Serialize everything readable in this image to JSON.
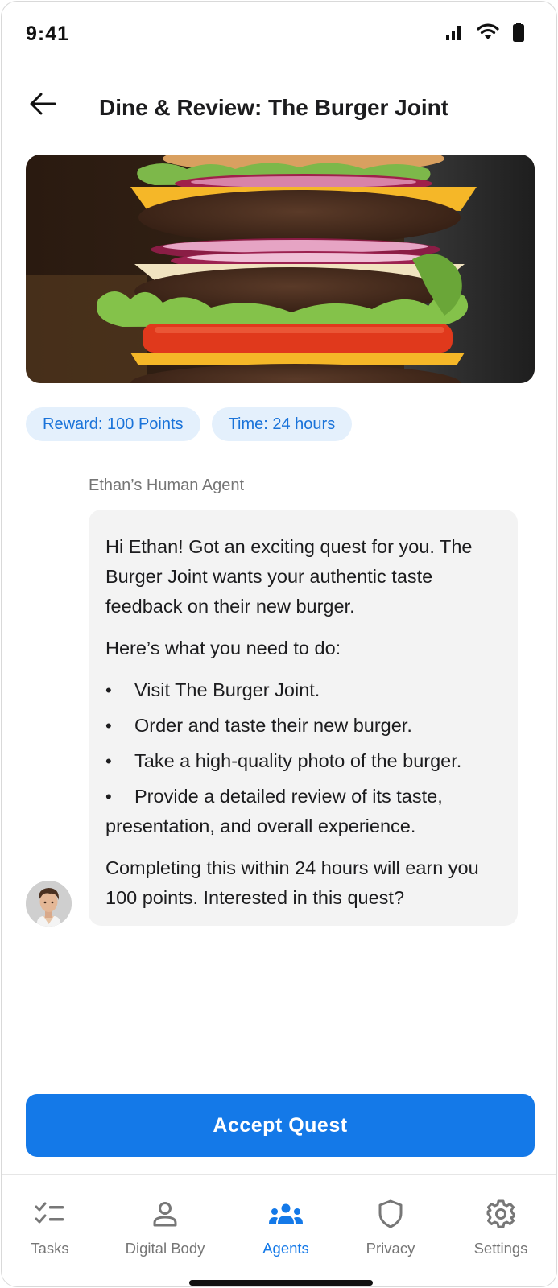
{
  "status_bar": {
    "time": "9:41"
  },
  "header": {
    "title": "Dine & Review: The Burger Joint"
  },
  "chips": [
    {
      "label": "Reward: 100 Points"
    },
    {
      "label": "Time: 24 hours"
    }
  ],
  "message": {
    "sender": "Ethan’s Human Agent",
    "intro": "Hi Ethan! Got an exciting quest for you. The Burger Joint wants your authentic taste feedback on their new burger.",
    "steps_heading": "Here’s what you need to do:",
    "steps": [
      "Visit The Burger Joint.",
      "Order and taste their new burger.",
      "Take a high-quality photo of the burger.",
      "Provide a detailed review of its taste, presentation, and overall experience."
    ],
    "outro": "Completing this within 24 hours will earn you 100 points. Interested in this quest?"
  },
  "cta": {
    "label": "Accept Quest"
  },
  "nav": {
    "items": [
      {
        "label": "Tasks",
        "icon": "tasks-checklist-icon"
      },
      {
        "label": "Digital Body",
        "icon": "person-icon"
      },
      {
        "label": "Agents",
        "icon": "group-icon"
      },
      {
        "label": "Privacy",
        "icon": "shield-icon"
      },
      {
        "label": "Settings",
        "icon": "gear-icon"
      }
    ],
    "active": "Agents"
  },
  "colors": {
    "accent": "#1479e8",
    "chip_bg": "#e4f0fc",
    "chip_text": "#1a73d9",
    "bubble_bg": "#f3f3f3"
  }
}
